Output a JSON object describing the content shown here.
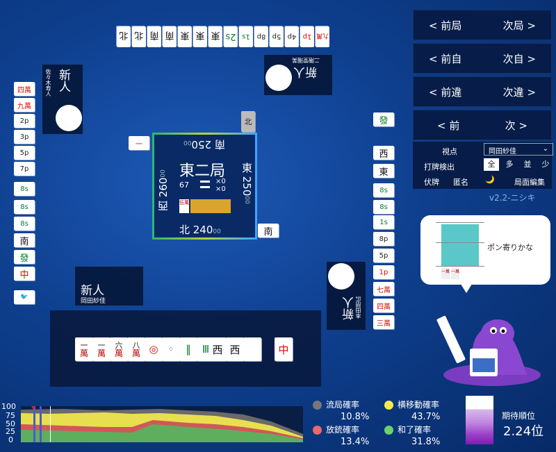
{
  "nav": {
    "prev_round": "< 前局",
    "next_round": "次局 >",
    "prev_self": "< 前自",
    "next_self": "次自 >",
    "prev_diff": "< 前違",
    "next_diff": "次違 >",
    "prev": "< 前",
    "next": "次 >"
  },
  "options": {
    "viewpoint_label": "視点",
    "viewpoint_value": "岡田紗佳",
    "detect_label": "打牌検出",
    "detect_opts": [
      "全",
      "多",
      "並",
      "少"
    ],
    "hidden_label": "伏牌",
    "anon_label": "匿名",
    "moon": "🌙",
    "edit_label": "局面編集",
    "version": "v2.2-ニシキ"
  },
  "center": {
    "round": "東二局",
    "count": "67",
    "honba": "×0",
    "riichi": "×0",
    "east": "東 250",
    "east_sub": "00",
    "south": "南 250",
    "south_sub": "00",
    "west": "西 260",
    "west_sub": "00",
    "north": "北 240",
    "north_sub": "00",
    "dora_label": "伍萬"
  },
  "players": {
    "bottom": {
      "rank": "新人",
      "name": "岡田紗佳"
    },
    "right": {
      "rank": "新人",
      "name": "本田朋広"
    },
    "top": {
      "rank": "新人",
      "name": "二階堂瑠美"
    },
    "left": {
      "rank": "新人",
      "name": "佐々木寿人"
    }
  },
  "bubble": {
    "text": "ポン寄りかな",
    "tile1": "一萬",
    "tile2": "一萬"
  },
  "stats": {
    "ryukyoku_label": "流局確率",
    "ryukyoku": "10.8%",
    "yokoido_label": "横移動確率",
    "yokoido": "43.7%",
    "hoju_label": "放銃確率",
    "hoju": "13.4%",
    "agari_label": "和了確率",
    "agari": "31.8%",
    "rank_label": "期待順位",
    "rank": "2.24位"
  },
  "graph": {
    "y_ticks": [
      "100",
      "75",
      "50",
      "25",
      "0"
    ]
  },
  "colors": {
    "ryukyoku": "#777777",
    "yokoido": "#f5ea4a",
    "hoju": "#e86a6a",
    "agari": "#6fcf6f"
  },
  "hand": [
    "一萬",
    "一萬",
    "六萬",
    "八萬",
    "1p",
    "8p",
    "3s",
    "8s",
    "西",
    "西",
    "白",
    "中"
  ],
  "top_discards": [
    "北",
    "北",
    "南",
    "南",
    "東",
    "東",
    "東",
    "2s",
    "1s",
    "8p",
    "5p",
    "4p",
    "1p",
    "九萬"
  ],
  "left_discards": [
    "四萬",
    "九萬",
    "2p",
    "3p",
    "5p",
    "7p",
    "8s",
    "8s",
    "8s",
    "南",
    "發",
    "中"
  ],
  "right_discards": [
    "發",
    "西",
    "東",
    "8s",
    "8s",
    "1s",
    "8p",
    "5p",
    "1p",
    "七萬",
    "四萬",
    "三萬"
  ]
}
